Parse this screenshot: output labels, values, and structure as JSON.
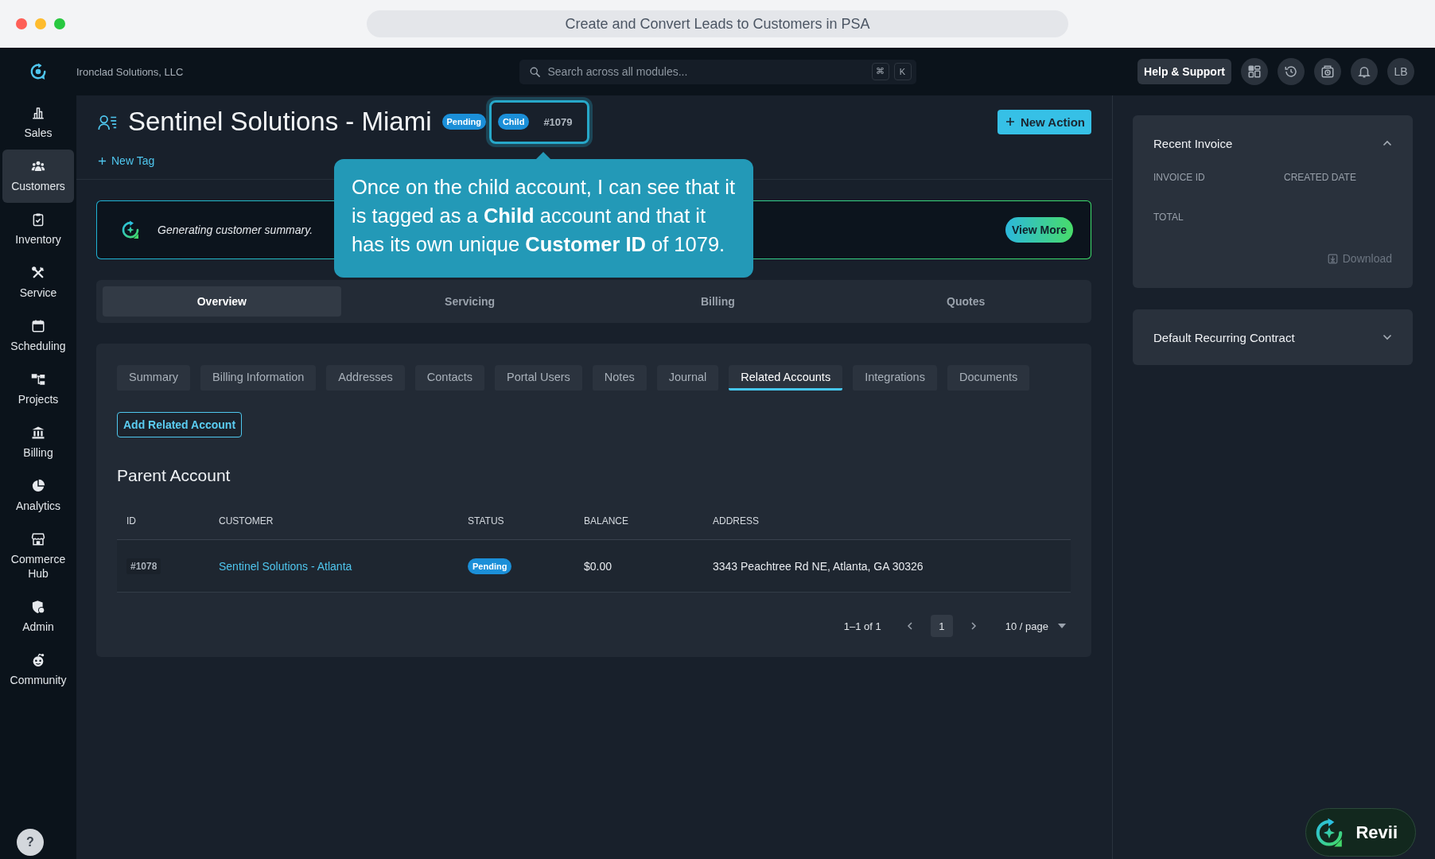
{
  "browser": {
    "title": "Create and Convert Leads to Customers in PSA"
  },
  "topbar": {
    "company": "Ironclad Solutions, LLC",
    "search": {
      "placeholder": "Search across all modules...",
      "keys": [
        "⌘",
        "K"
      ]
    },
    "help_button": "Help & Support",
    "avatar": "LB"
  },
  "sidebar": {
    "items": [
      {
        "label": "Sales",
        "selected": false
      },
      {
        "label": "Customers",
        "selected": true
      },
      {
        "label": "Inventory",
        "selected": false
      },
      {
        "label": "Service",
        "selected": false
      },
      {
        "label": "Scheduling",
        "selected": false
      },
      {
        "label": "Projects",
        "selected": false
      },
      {
        "label": "Billing",
        "selected": false
      },
      {
        "label": "Analytics",
        "selected": false
      },
      {
        "label": "Commerce Hub",
        "selected": false
      },
      {
        "label": "Admin",
        "selected": false
      },
      {
        "label": "Community",
        "selected": false
      }
    ],
    "help_button": "?"
  },
  "header": {
    "title": "Sentinel Solutions - Miami",
    "status": "Pending",
    "tag": "Child",
    "customer_id": "#1079",
    "highlighted": true,
    "new_tag": "New Tag",
    "new_action": "New Action"
  },
  "callout": {
    "text": "Once on the child account, I can see that it is tagged as a **Child** account and that it has its own unique **Customer ID** of 1079."
  },
  "summary_banner": {
    "text": "Generating customer summary.",
    "button": "View More"
  },
  "main_tabs": [
    {
      "label": "Overview",
      "selected": true
    },
    {
      "label": "Servicing",
      "selected": false
    },
    {
      "label": "Billing",
      "selected": false
    },
    {
      "label": "Quotes",
      "selected": false
    }
  ],
  "sub_tabs": [
    {
      "label": "Summary",
      "selected": false
    },
    {
      "label": "Billing Information",
      "selected": false
    },
    {
      "label": "Addresses",
      "selected": false
    },
    {
      "label": "Contacts",
      "selected": false
    },
    {
      "label": "Portal Users",
      "selected": false
    },
    {
      "label": "Notes",
      "selected": false
    },
    {
      "label": "Journal",
      "selected": false
    },
    {
      "label": "Related Accounts",
      "selected": true
    },
    {
      "label": "Integrations",
      "selected": false
    },
    {
      "label": "Documents",
      "selected": false
    }
  ],
  "related_accounts": {
    "add_button": "Add Related Account",
    "section_title": "Parent Account",
    "columns": [
      "ID",
      "CUSTOMER",
      "STATUS",
      "BALANCE",
      "ADDRESS"
    ],
    "rows": [
      {
        "id": "#1078",
        "customer": "Sentinel Solutions - Atlanta",
        "status": "Pending",
        "balance": "$0.00",
        "address": "3343 Peachtree Rd NE, Atlanta, GA 30326"
      }
    ],
    "pagination": {
      "range": "1–1 of 1",
      "pages": [
        {
          "label": "1",
          "selected": true
        }
      ],
      "page_size": "10 / page"
    }
  },
  "right_panel": {
    "cards": [
      {
        "title": "Recent Invoice",
        "expanded": true,
        "fields": [
          "INVOICE ID",
          "CREATED DATE",
          "TOTAL"
        ],
        "action": "Download"
      },
      {
        "title": "Default Recurring Contract",
        "expanded": false
      }
    ]
  },
  "assistant": {
    "label": "Revii"
  }
}
